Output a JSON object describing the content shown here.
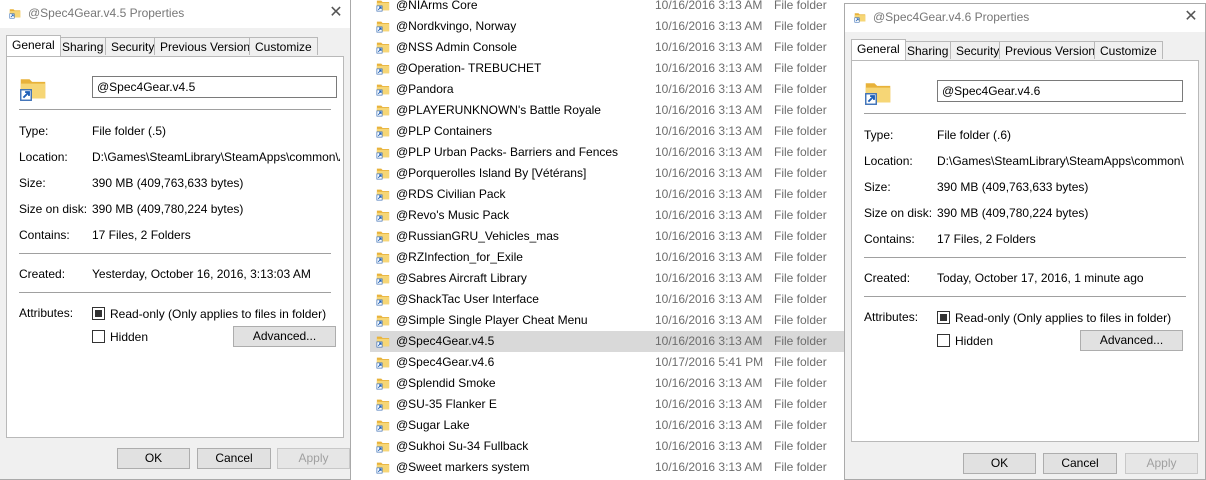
{
  "colors": {
    "folder_yellow": "#f2c75c",
    "selection": "#d9d9d9",
    "dialog_bg": "#f0f0f0"
  },
  "icons": {
    "folder": "folder-shortcut-icon",
    "close": "close-icon"
  },
  "explorer": {
    "items": [
      {
        "name": "@NIArms Core",
        "date": "10/16/2016 3:13 AM",
        "type": "File folder"
      },
      {
        "name": "@Nordkvingo, Norway",
        "date": "10/16/2016 3:13 AM",
        "type": "File folder"
      },
      {
        "name": "@NSS Admin Console",
        "date": "10/16/2016 3:13 AM",
        "type": "File folder"
      },
      {
        "name": "@Operation- TREBUCHET",
        "date": "10/16/2016 3:13 AM",
        "type": "File folder"
      },
      {
        "name": "@Pandora",
        "date": "10/16/2016 3:13 AM",
        "type": "File folder"
      },
      {
        "name": "@PLAYERUNKNOWN's Battle Royale",
        "date": "10/16/2016 3:13 AM",
        "type": "File folder"
      },
      {
        "name": "@PLP Containers",
        "date": "10/16/2016 3:13 AM",
        "type": "File folder"
      },
      {
        "name": "@PLP Urban Packs- Barriers and Fences",
        "date": "10/16/2016 3:13 AM",
        "type": "File folder"
      },
      {
        "name": "@Porquerolles Island By [Vétérans]",
        "date": "10/16/2016 3:13 AM",
        "type": "File folder"
      },
      {
        "name": "@RDS Civilian Pack",
        "date": "10/16/2016 3:13 AM",
        "type": "File folder"
      },
      {
        "name": "@Revo's Music Pack",
        "date": "10/16/2016 3:13 AM",
        "type": "File folder"
      },
      {
        "name": "@RussianGRU_Vehicles_mas",
        "date": "10/16/2016 3:13 AM",
        "type": "File folder"
      },
      {
        "name": "@RZInfection_for_Exile",
        "date": "10/16/2016 3:13 AM",
        "type": "File folder"
      },
      {
        "name": "@Sabres Aircraft Library",
        "date": "10/16/2016 3:13 AM",
        "type": "File folder"
      },
      {
        "name": "@ShackTac User Interface",
        "date": "10/16/2016 3:13 AM",
        "type": "File folder"
      },
      {
        "name": "@Simple Single Player Cheat Menu",
        "date": "10/16/2016 3:13 AM",
        "type": "File folder"
      },
      {
        "name": "@Spec4Gear.v4.5",
        "date": "10/16/2016 3:13 AM",
        "type": "File folder",
        "selected": true
      },
      {
        "name": "@Spec4Gear.v4.6",
        "date": "10/17/2016 5:41 PM",
        "type": "File folder"
      },
      {
        "name": "@Splendid Smoke",
        "date": "10/16/2016 3:13 AM",
        "type": "File folder"
      },
      {
        "name": "@SU-35 Flanker E",
        "date": "10/16/2016 3:13 AM",
        "type": "File folder"
      },
      {
        "name": "@Sugar Lake",
        "date": "10/16/2016 3:13 AM",
        "type": "File folder"
      },
      {
        "name": "@Sukhoi Su-34 Fullback",
        "date": "10/16/2016 3:13 AM",
        "type": "File folder"
      },
      {
        "name": "@Sweet markers system",
        "date": "10/16/2016 3:13 AM",
        "type": "File folder"
      }
    ]
  },
  "dialog_left": {
    "title": "@Spec4Gear.v4.5 Properties",
    "close": "✕",
    "tabs": [
      "General",
      "Sharing",
      "Security",
      "Previous Versions",
      "Customize"
    ],
    "name_value": "@Spec4Gear.v4.5",
    "labels": {
      "type": "Type:",
      "location": "Location:",
      "size": "Size:",
      "size_on_disk": "Size on disk:",
      "contains": "Contains:",
      "created": "Created:",
      "attributes": "Attributes:"
    },
    "values": {
      "type": "File folder (.5)",
      "location": "D:\\Games\\SteamLibrary\\SteamApps\\common\\Arma",
      "size": "390 MB (409,763,633 bytes)",
      "size_on_disk": "390 MB (409,780,224 bytes)",
      "contains": "17 Files, 2 Folders",
      "created": "Yesterday, October 16, 2016, 3:13:03 AM"
    },
    "readonly_label": "Read-only (Only applies to files in folder)",
    "readonly_checked": true,
    "hidden_label": "Hidden",
    "hidden_checked": false,
    "advanced_label": "Advanced...",
    "ok_label": "OK",
    "cancel_label": "Cancel",
    "apply_label": "Apply"
  },
  "dialog_right": {
    "title": "@Spec4Gear.v4.6 Properties",
    "close": "✕",
    "tabs": [
      "General",
      "Sharing",
      "Security",
      "Previous Versions",
      "Customize"
    ],
    "name_value": "@Spec4Gear.v4.6",
    "labels": {
      "type": "Type:",
      "location": "Location:",
      "size": "Size:",
      "size_on_disk": "Size on disk:",
      "contains": "Contains:",
      "created": "Created:",
      "attributes": "Attributes:"
    },
    "values": {
      "type": "File folder (.6)",
      "location": "D:\\Games\\SteamLibrary\\SteamApps\\common\\Arma",
      "size": "390 MB (409,763,633 bytes)",
      "size_on_disk": "390 MB (409,780,224 bytes)",
      "contains": "17 Files, 2 Folders",
      "created": "Today, October 17, 2016, 1 minute ago"
    },
    "readonly_label": "Read-only (Only applies to files in folder)",
    "readonly_checked": true,
    "hidden_label": "Hidden",
    "hidden_checked": false,
    "advanced_label": "Advanced...",
    "ok_label": "OK",
    "cancel_label": "Cancel",
    "apply_label": "Apply"
  }
}
